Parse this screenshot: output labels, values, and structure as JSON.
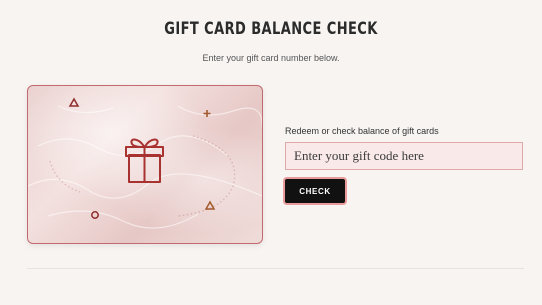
{
  "page": {
    "title": "GIFT CARD BALANCE CHECK",
    "subtitle": "Enter your gift card number below."
  },
  "card": {
    "icons": [
      "gift-icon",
      "triangle-icon",
      "plus-icon",
      "circle-icon",
      "triangle-icon"
    ],
    "accent_color": "#a8322f"
  },
  "form": {
    "label": "Redeem or check balance of gift cards",
    "placeholder": "Enter your gift code here",
    "button_label": "CHECK"
  },
  "colors": {
    "button_bg": "#111111",
    "button_glow": "#e99a9a",
    "input_bg": "#f9e9e9",
    "input_border": "#e0a8aa",
    "card_border": "#c26a70"
  }
}
